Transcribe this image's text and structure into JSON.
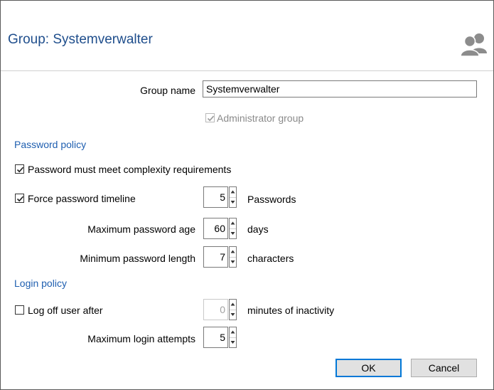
{
  "dialog": {
    "title": "Group: Systemverwalter",
    "icon": "users-icon"
  },
  "group": {
    "name_label": "Group name",
    "name_value": "Systemverwalter",
    "admin_label": "Administrator group",
    "admin_checked": true,
    "admin_disabled": true
  },
  "password_policy": {
    "header": "Password policy",
    "complexity_label": "Password must meet complexity requirements",
    "complexity_checked": true,
    "timeline_label": "Force password timeline",
    "timeline_checked": true,
    "timeline_value": "5",
    "timeline_unit": "Passwords",
    "max_age_label": "Maximum password age",
    "max_age_value": "60",
    "max_age_unit": "days",
    "min_length_label": "Minimum password length",
    "min_length_value": "7",
    "min_length_unit": "characters"
  },
  "login_policy": {
    "header": "Login policy",
    "logoff_label": "Log off user after",
    "logoff_checked": false,
    "logoff_value": "0",
    "logoff_unit": "minutes of inactivity",
    "max_attempts_label": "Maximum login attempts",
    "max_attempts_value": "5"
  },
  "buttons": {
    "ok": "OK",
    "cancel": "Cancel"
  },
  "colors": {
    "title": "#1f4e8c",
    "section": "#1f5fb0",
    "ok_border": "#0078d7",
    "icon": "#8c8c8c"
  }
}
